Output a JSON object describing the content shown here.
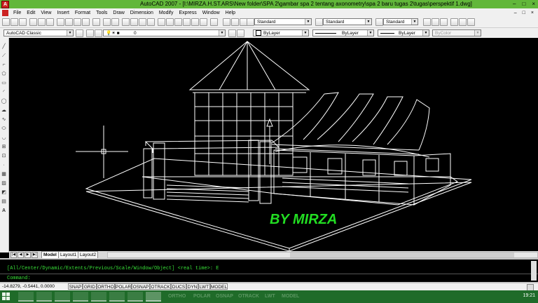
{
  "window": {
    "title": "AutoCAD 2007 - [I:\\MIRZA.H.ST.ARS\\New folder\\SPA 2\\gambar spa 2 tentang axonometry\\spa 2 baru tugas 2\\tugas\\perspektif 1.dwg]",
    "app_icon": "autocad-app-icon",
    "controls": [
      "–",
      "□",
      "×"
    ]
  },
  "menu": {
    "items": [
      "File",
      "Edit",
      "View",
      "Insert",
      "Format",
      "Tools",
      "Draw",
      "Dimension",
      "Modify",
      "Express",
      "Window",
      "Help"
    ],
    "mdi_controls": [
      "–",
      "□",
      "×"
    ]
  },
  "toolbar_styles": {
    "text_style": "Standard",
    "dim_style": "Standard",
    "table_style": "Standard"
  },
  "toolbar_props": {
    "workspace": "AutoCAD Classic",
    "layer": "0",
    "color": "ByLayer",
    "linetype": "ByLayer",
    "lineweight": "ByLayer",
    "plot_style": "ByColor"
  },
  "drawing": {
    "watermark": "BY MIRZA",
    "colors": {
      "lines": "#ffffff",
      "watermark": "#22dd22",
      "background": "#000000"
    }
  },
  "layout_tabs": {
    "tabs": [
      "Model",
      "Layout1",
      "Layout2"
    ],
    "active": "Model",
    "nav": [
      "|◀",
      "◀",
      "▶",
      "▶|"
    ]
  },
  "command": {
    "history": "[All/Center/Dynamic/Extents/Previous/Scale/Window/Object] <real time>: E",
    "prompt": "Command:",
    "color": "#38e038"
  },
  "status": {
    "coords": "-14.8279, -0.5441, 0.0000",
    "toggles": [
      "SNAP",
      "GRID",
      "ORTHO",
      "POLAR",
      "OSNAP",
      "OTRACK",
      "DUCS",
      "DYN",
      "LWT",
      "MODEL"
    ]
  },
  "taskbar": {
    "ghost_toggles": [
      "ORTHO",
      "POLAR",
      "OSNAP",
      "OTRACK",
      "LWT",
      "MODEL"
    ],
    "clock": "19:21",
    "color": "#1f6b29"
  }
}
